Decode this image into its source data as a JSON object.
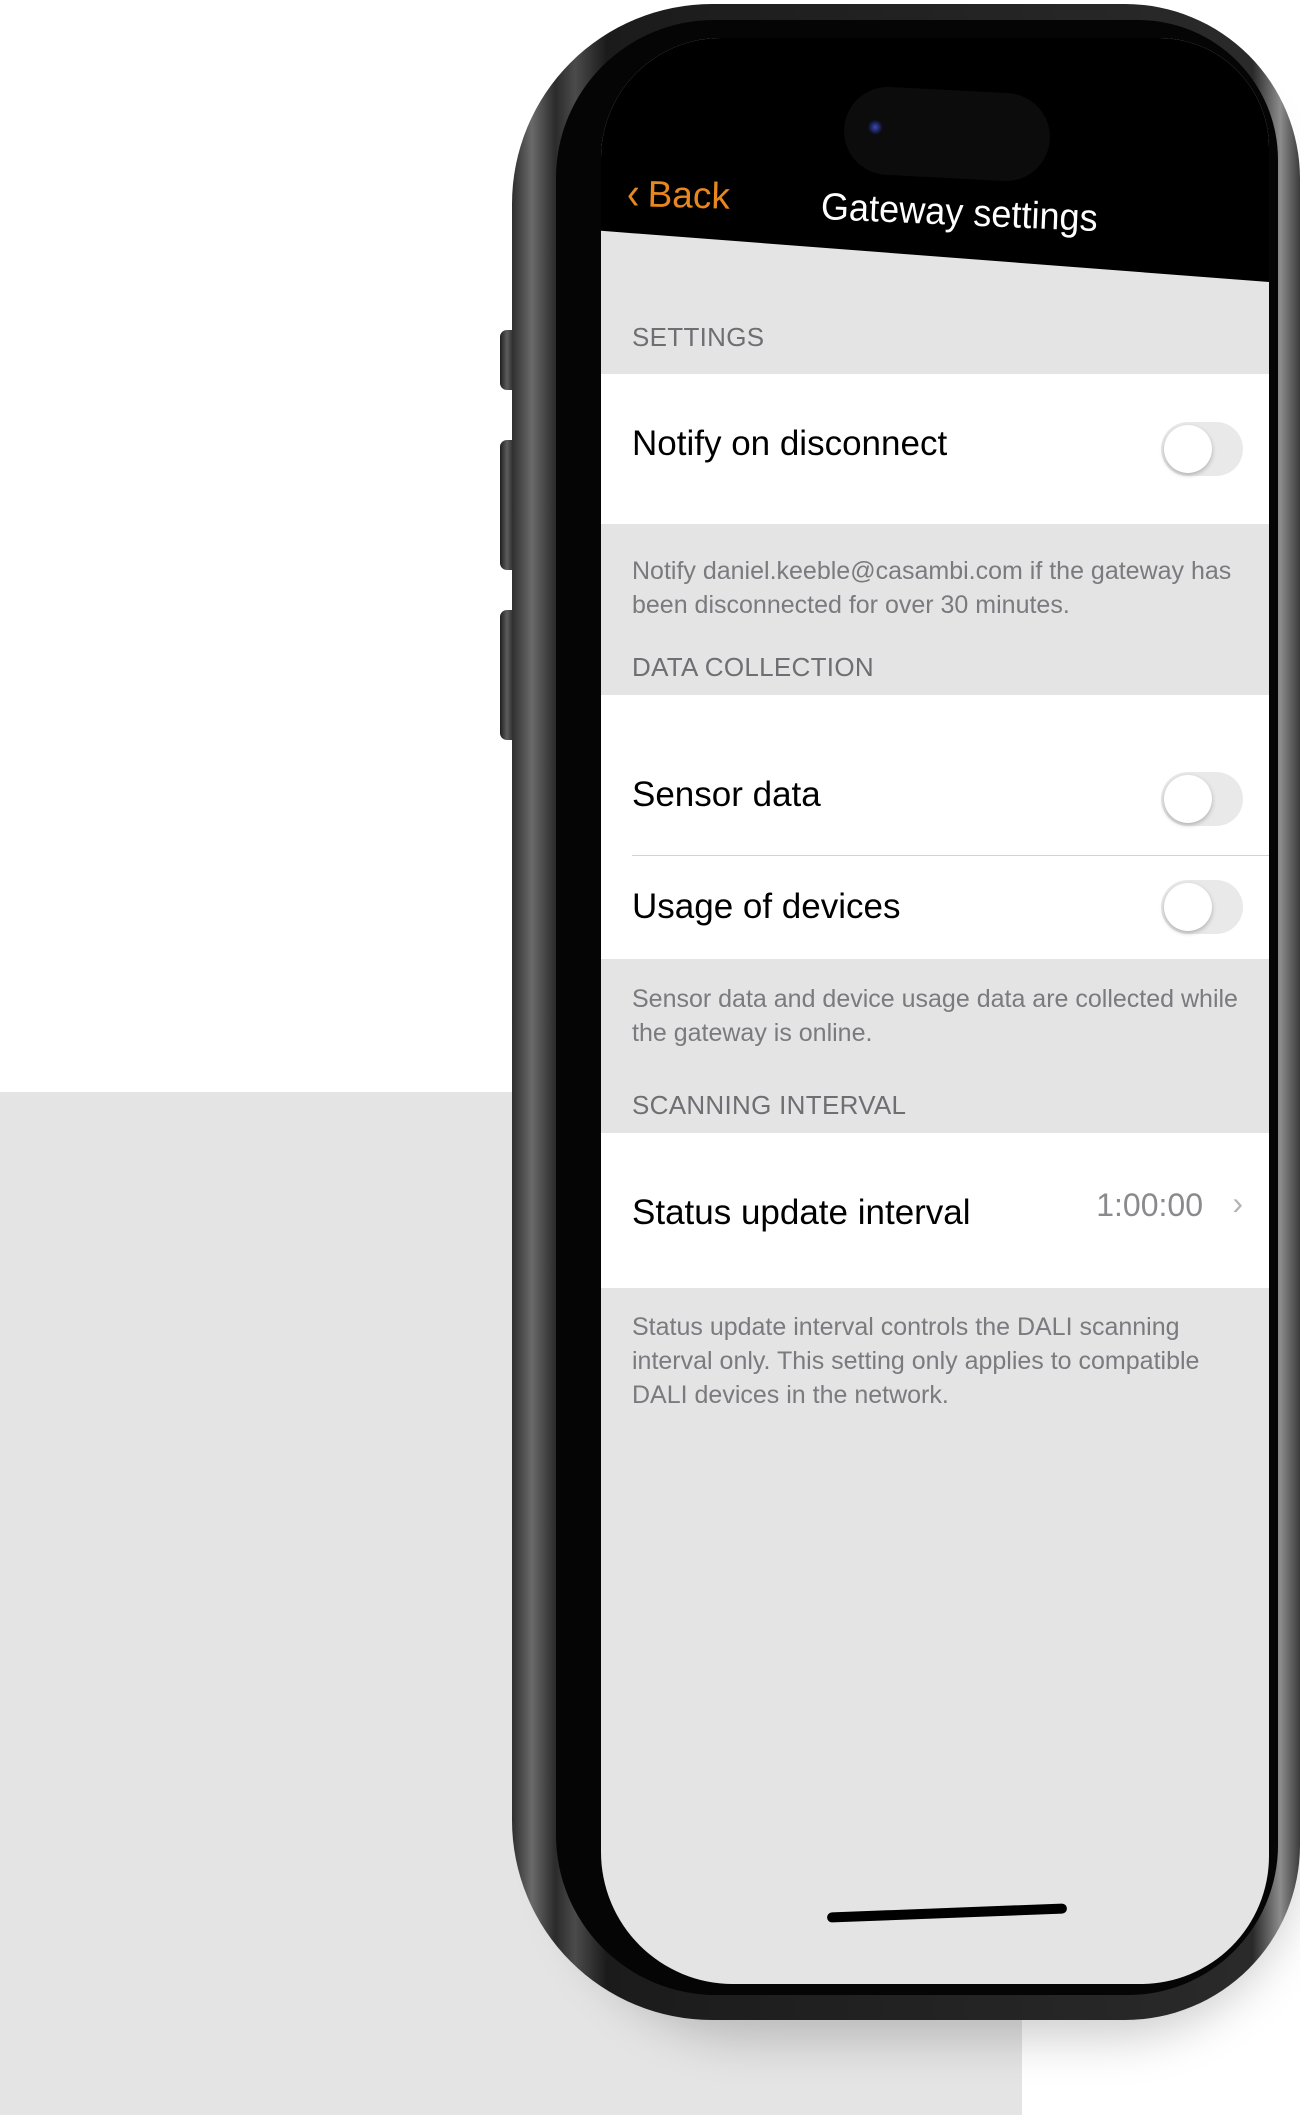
{
  "nav": {
    "back_label": "Back",
    "title": "Gateway settings"
  },
  "sections": {
    "settings": {
      "header": "SETTINGS",
      "notify_label": "Notify on disconnect",
      "notify_on": false,
      "footer": "Notify daniel.keeble@casambi.com if the gateway has been disconnected for over 30 minutes."
    },
    "data_collection": {
      "header": "DATA COLLECTION",
      "sensor_label": "Sensor data",
      "sensor_on": false,
      "usage_label": "Usage of devices",
      "usage_on": false,
      "footer": "Sensor data and device usage data are collected while the gateway is online."
    },
    "scanning_interval": {
      "header": "SCANNING INTERVAL",
      "status_label": "Status update interval",
      "status_value": "1:00:00",
      "footer": "Status update interval controls the DALI scanning interval only. This setting only applies to compatible DALI devices in the network."
    }
  },
  "colors": {
    "accent": "#e8871e",
    "grouped_background": "#e4e4e4",
    "nav_background": "#000000"
  }
}
